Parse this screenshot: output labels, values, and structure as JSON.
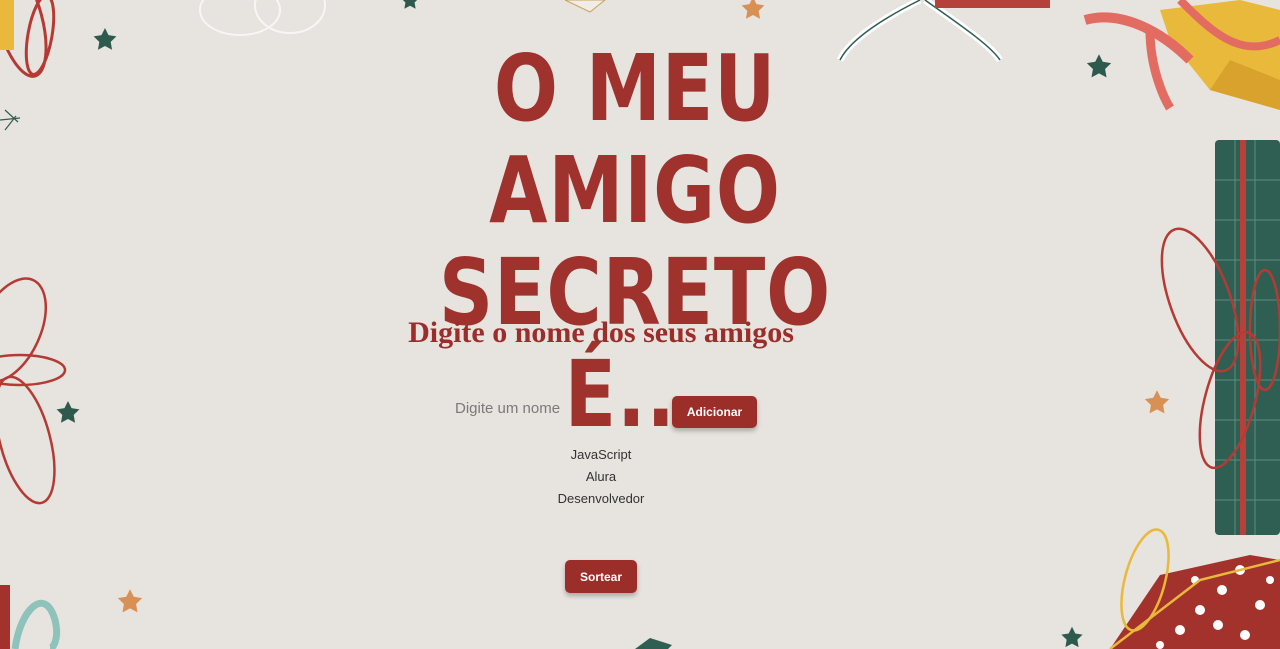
{
  "header": {
    "title_line1": "O MEU AMIGO",
    "title_line2": "SECRETO É..."
  },
  "form": {
    "subtitle": "Digite o nome dos seus amigos",
    "input_placeholder": "Digite um nome",
    "input_value": "",
    "add_button_label": "Adicionar"
  },
  "friends": {
    "names": [
      "JavaScript",
      "Alura",
      "Desenvolvedor"
    ]
  },
  "actions": {
    "draw_button_label": "Sortear"
  },
  "colors": {
    "background": "#e7e3de",
    "accent_red": "#9c2e2a",
    "gift_green": "#2f5e52",
    "gift_gold": "#e8b93a",
    "star_green": "#2e5a4e",
    "star_orange": "#d99055"
  }
}
